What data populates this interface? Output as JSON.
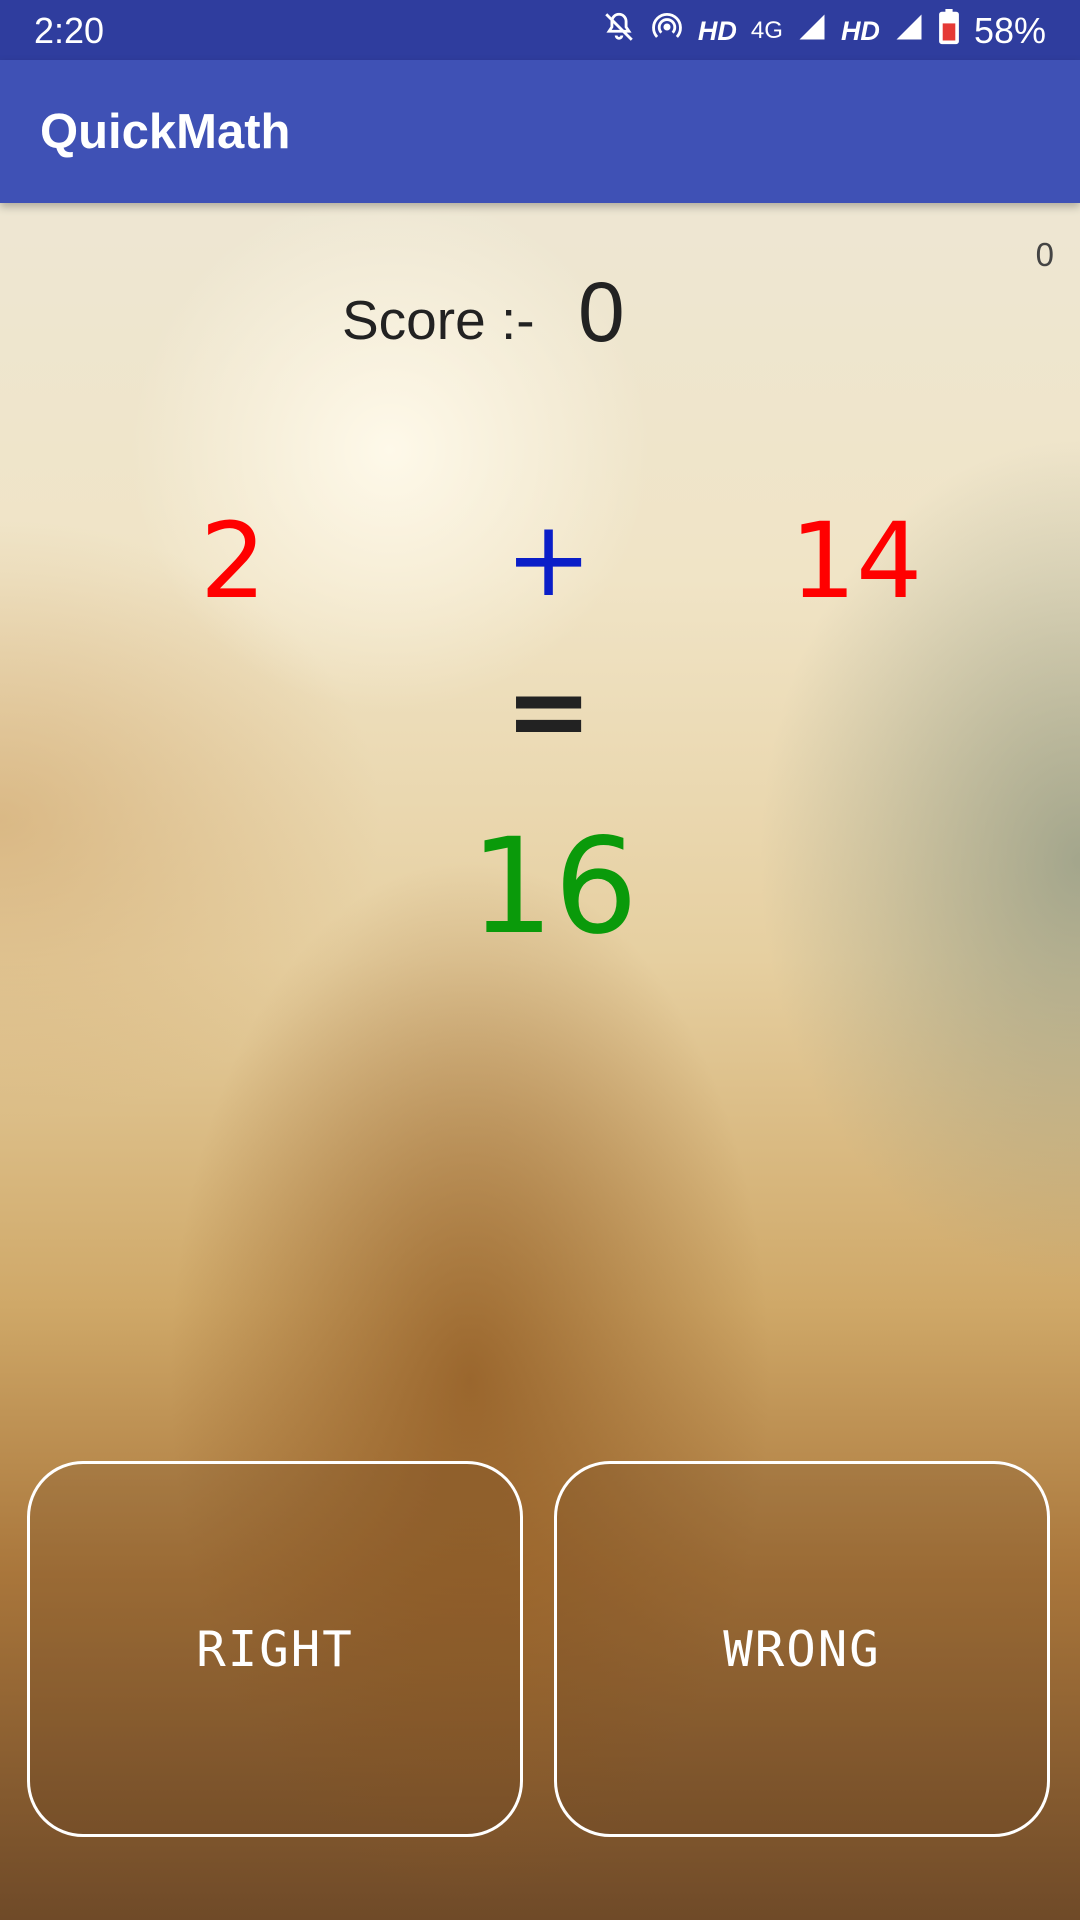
{
  "status_bar": {
    "time": "2:20",
    "icons": [
      "bell-off-icon",
      "hotspot-icon",
      "signal-icon",
      "battery-icon"
    ],
    "hd1": "HD",
    "network": "4G",
    "hd2": "HD",
    "battery": "58%"
  },
  "app_bar": {
    "title": "QuickMath",
    "color": "#3f51b5"
  },
  "game": {
    "corner_count": "0",
    "score_label": "Score :-",
    "score_value": "0",
    "operand_a": "2",
    "operator": "+",
    "operand_b": "14",
    "equals": "=",
    "result": "16",
    "colors": {
      "operand": "#ff0000",
      "operator": "#0a1ec8",
      "result": "#0a9a0a"
    }
  },
  "buttons": {
    "right_label": "RIGHT",
    "wrong_label": "WRONG"
  }
}
